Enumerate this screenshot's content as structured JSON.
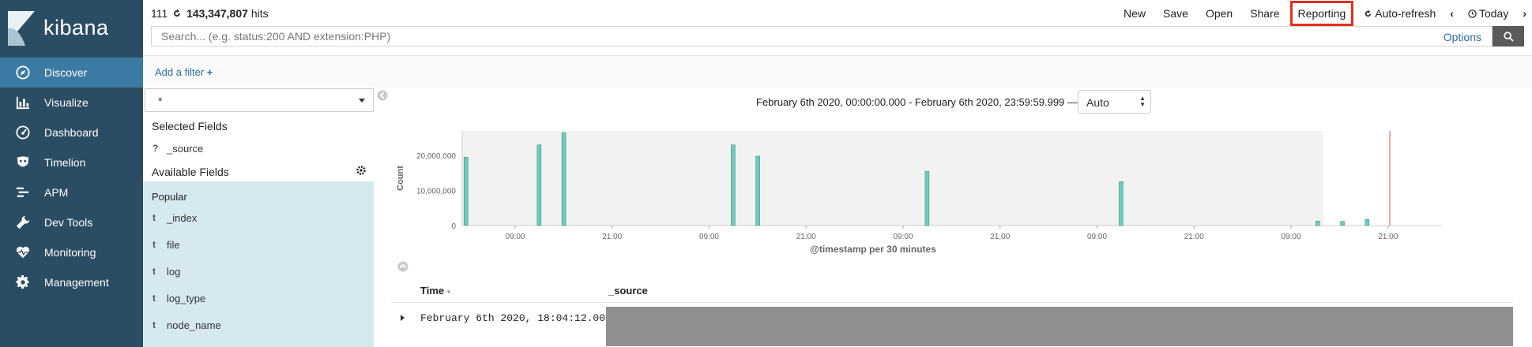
{
  "app": {
    "brand": "kibana"
  },
  "sidebar": {
    "items": [
      {
        "label": "Discover",
        "icon": "compass-icon",
        "active": true
      },
      {
        "label": "Visualize",
        "icon": "bar-chart-icon"
      },
      {
        "label": "Dashboard",
        "icon": "dashboard-gauge-icon"
      },
      {
        "label": "Timelion",
        "icon": "timelion-mask-icon"
      },
      {
        "label": "APM",
        "icon": "apm-bars-icon"
      },
      {
        "label": "Dev Tools",
        "icon": "wrench-icon"
      },
      {
        "label": "Monitoring",
        "icon": "heartbeat-icon"
      },
      {
        "label": "Management",
        "icon": "gear-icon"
      }
    ]
  },
  "header": {
    "hits_prefix": "111",
    "hits_count": "143,347,807",
    "hits_suffix": "hits",
    "toolbar": {
      "new": "New",
      "save": "Save",
      "open": "Open",
      "share": "Share",
      "reporting": "Reporting",
      "auto_refresh": "Auto-refresh",
      "today": "Today"
    },
    "search": {
      "placeholder": "Search... (e.g. status:200 AND extension:PHP)",
      "options": "Options"
    },
    "add_filter": "Add a filter"
  },
  "fields": {
    "index_pattern": "*",
    "selected_title": "Selected Fields",
    "selected": [
      {
        "type": "?",
        "name": "_source"
      }
    ],
    "available_title": "Available Fields",
    "popular_title": "Popular",
    "popular": [
      {
        "type": "t",
        "name": "_index"
      },
      {
        "type": "t",
        "name": "file"
      },
      {
        "type": "t",
        "name": "log"
      },
      {
        "type": "t",
        "name": "log_type"
      },
      {
        "type": "t",
        "name": "node_name"
      }
    ]
  },
  "histogram": {
    "date_range": "February 6th 2020, 00:00:00.000 - February 6th 2020, 23:59:59.999 —",
    "interval": "Auto"
  },
  "chart_data": {
    "type": "bar",
    "ylabel": "Count",
    "xlabel": "@timestamp per 30 minutes",
    "ylim": [
      0,
      27000000
    ],
    "yticks": [
      {
        "value": 0,
        "label": "0"
      },
      {
        "value": 10000000,
        "label": "10,000,000"
      },
      {
        "value": 20000000,
        "label": "20,000,000"
      }
    ],
    "xticks": [
      {
        "pos": 0.06,
        "label": "09:00"
      },
      {
        "pos": 0.17,
        "label": "21:00"
      },
      {
        "pos": 0.28,
        "label": "09:00"
      },
      {
        "pos": 0.39,
        "label": "21:00"
      },
      {
        "pos": 0.5,
        "label": "09:00"
      },
      {
        "pos": 0.61,
        "label": "21:00"
      },
      {
        "pos": 0.72,
        "label": "09:00"
      },
      {
        "pos": 0.83,
        "label": "21:00"
      },
      {
        "pos": 0.94,
        "label": "09:00"
      },
      {
        "pos": 1.05,
        "label": "21:00"
      }
    ],
    "bars": [
      {
        "pos": 0.002,
        "value": 19500000
      },
      {
        "pos": 0.085,
        "value": 23000000
      },
      {
        "pos": 0.113,
        "value": 26500000
      },
      {
        "pos": 0.305,
        "value": 23000000
      },
      {
        "pos": 0.333,
        "value": 19800000
      },
      {
        "pos": 0.525,
        "value": 15500000
      },
      {
        "pos": 0.745,
        "value": 12500000
      },
      {
        "pos": 0.968,
        "value": 1300000
      },
      {
        "pos": 0.996,
        "value": 1200000
      },
      {
        "pos": 1.024,
        "value": 1700000
      }
    ],
    "now_marker_pos": 1.052
  },
  "table": {
    "col_time": "Time",
    "col_source": "_source",
    "rows": [
      {
        "time": "February 6th 2020, 18:04:12.000"
      }
    ]
  },
  "colors": {
    "sidebar": "#2b4d63",
    "active": "#3b7aa2",
    "bar": "#6ecabc",
    "highlight": "#e0301e",
    "link": "#2d6da3"
  }
}
